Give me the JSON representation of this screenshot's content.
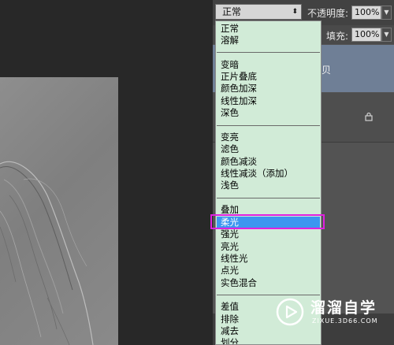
{
  "toolbar": {
    "blend_mode_value": "正常",
    "opacity_label": "不透明度:",
    "opacity_value": "100%",
    "fill_label": "填充:",
    "fill_value": "100%"
  },
  "layers": {
    "selected_layer_text": "贝"
  },
  "blend_menu": {
    "groups": [
      [
        "正常",
        "溶解"
      ],
      [
        "变暗",
        "正片叠底",
        "颜色加深",
        "线性加深",
        "深色"
      ],
      [
        "变亮",
        "滤色",
        "颜色减淡",
        "线性减淡（添加）",
        "浅色"
      ],
      [
        "叠加",
        "柔光",
        "强光",
        "亮光",
        "线性光",
        "点光",
        "实色混合"
      ],
      [
        "差值",
        "排除",
        "减去",
        "划分"
      ]
    ],
    "selected": "柔光"
  },
  "watermark": {
    "title": "溜溜自学",
    "url": "ZIXUE.3D66.COM"
  }
}
